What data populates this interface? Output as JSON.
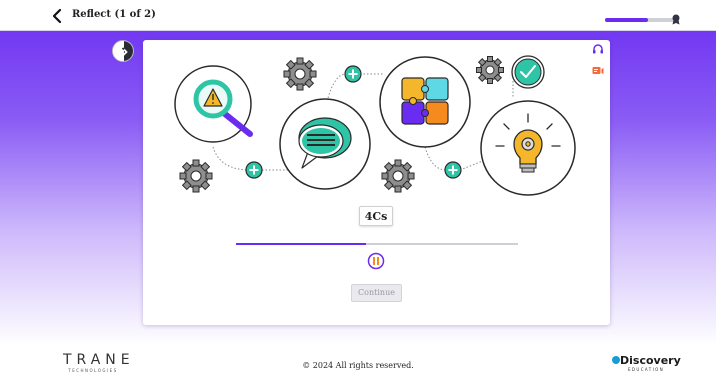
{
  "topbar": {
    "title": "Reflect (1 of 2)",
    "back_icon": "chevron-left-icon",
    "progress": 0.6,
    "progress_color": "#6a2cf0"
  },
  "sidebar": {
    "toggle_icon": "chevron-right-icon"
  },
  "card": {
    "audio_icon": "headphones-icon",
    "caption_icon": "closed-captions-icon",
    "illustration": {
      "icons": [
        "magnifier-warning-icon",
        "speech-bubble-icon",
        "puzzle-icon",
        "lightbulb-gear-icon",
        "checkmark-icon",
        "gear-icon",
        "plus-icon"
      ],
      "accent_color": "#2ec4a6",
      "purple_color": "#6a2cf0"
    },
    "chip_label": "4Cs",
    "media_progress": 0.46,
    "pause_icon": "pause-icon",
    "continue_label": "Continue"
  },
  "footer": {
    "left_brand": "TRANE",
    "left_brand_sub": "TECHNOLOGIES",
    "copyright": "© 2024 All rights reserved.",
    "right_brand": "Discovery",
    "right_brand_sub": "EDUCATION"
  }
}
